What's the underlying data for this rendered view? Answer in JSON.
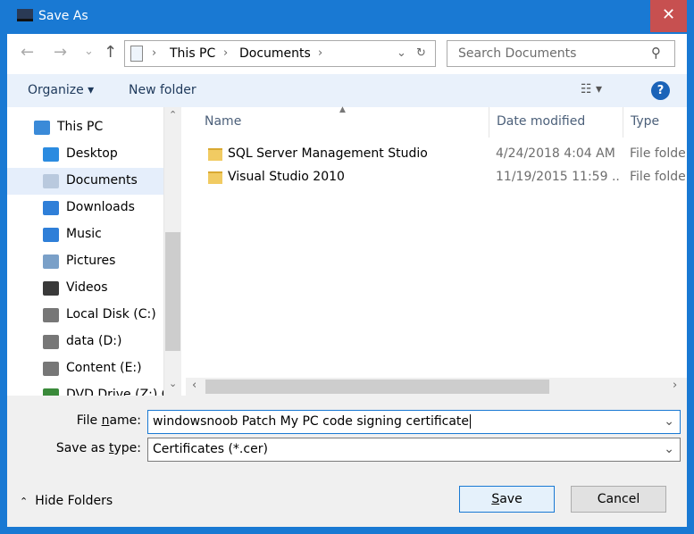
{
  "window": {
    "title": "Save As",
    "close_glyph": "✕"
  },
  "nav": {
    "back": "←",
    "forward": "→",
    "recent": "⌄",
    "up": "↑",
    "breadcrumb": [
      "This PC",
      "Documents"
    ],
    "search_placeholder": "Search Documents"
  },
  "toolbar": {
    "organize": "Organize ▾",
    "new_folder": "New folder",
    "view": "☷ ▾",
    "help": "?"
  },
  "sidebar": {
    "items": [
      {
        "label": "This PC",
        "icon": "computer-icon",
        "color": "#3a8ad8"
      },
      {
        "label": "Desktop",
        "icon": "desktop-icon",
        "color": "#2b8be0"
      },
      {
        "label": "Documents",
        "icon": "documents-icon",
        "color": "#b9c9de",
        "selected": true
      },
      {
        "label": "Downloads",
        "icon": "downloads-icon",
        "color": "#2f7fd8"
      },
      {
        "label": "Music",
        "icon": "music-icon",
        "color": "#2f7fd8"
      },
      {
        "label": "Pictures",
        "icon": "pictures-icon",
        "color": "#7aa0c8"
      },
      {
        "label": "Videos",
        "icon": "videos-icon",
        "color": "#3a3a3a"
      },
      {
        "label": "Local Disk (C:)",
        "icon": "drive-icon",
        "color": "#777"
      },
      {
        "label": "data (D:)",
        "icon": "drive-icon",
        "color": "#777"
      },
      {
        "label": "Content (E:)",
        "icon": "drive-icon",
        "color": "#777"
      },
      {
        "label": "DVD Drive (Z:) C",
        "icon": "dvd-drive-icon",
        "color": "#3a8a3a"
      }
    ]
  },
  "columns": [
    "Name",
    "Date modified",
    "Type"
  ],
  "files": [
    {
      "name": "SQL Server Management Studio",
      "date": "4/24/2018 4:04 AM",
      "type": "File folder"
    },
    {
      "name": "Visual Studio 2010",
      "date": "11/19/2015 11:59 ...",
      "type": "File folder"
    }
  ],
  "form": {
    "filename_label": {
      "pre": "File ",
      "key": "n",
      "post": "ame:"
    },
    "filename_value": "windowsnoob Patch My PC code signing certificate",
    "type_label": {
      "pre": "Save as ",
      "key": "t",
      "post": "ype:"
    },
    "type_value": "Certificates (*.cer)",
    "hide_folders": "Hide Folders",
    "save": {
      "key": "S",
      "post": "ave"
    },
    "cancel": "Cancel"
  }
}
